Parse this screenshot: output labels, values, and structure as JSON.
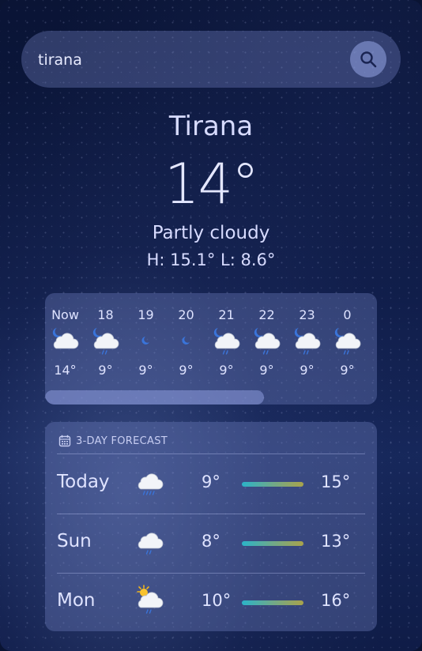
{
  "search": {
    "value": "tirana"
  },
  "current": {
    "city": "Tirana",
    "temperature": "14°",
    "condition": "Partly cloudy",
    "hilo": "H: 15.1° L: 8.6°"
  },
  "hourly": [
    {
      "time": "Now",
      "icon": "moon-cloud-icon",
      "temp": "14°"
    },
    {
      "time": "18",
      "icon": "moon-cloud-rain-icon",
      "temp": "9°"
    },
    {
      "time": "19",
      "icon": "moon-icon",
      "temp": "9°"
    },
    {
      "time": "20",
      "icon": "moon-icon",
      "temp": "9°"
    },
    {
      "time": "21",
      "icon": "moon-cloud-rain-icon",
      "temp": "9°"
    },
    {
      "time": "22",
      "icon": "moon-cloud-rain-icon",
      "temp": "9°"
    },
    {
      "time": "23",
      "icon": "moon-cloud-rain-icon",
      "temp": "9°"
    },
    {
      "time": "0",
      "icon": "moon-cloud-rain-icon",
      "temp": "9°"
    }
  ],
  "forecast": {
    "title": "3-DAY FORECAST",
    "days": [
      {
        "day": "Today",
        "icon": "cloud-heavy-rain-icon",
        "low": "9°",
        "high": "15°"
      },
      {
        "day": "Sun",
        "icon": "cloud-rain-icon",
        "low": "8°",
        "high": "13°"
      },
      {
        "day": "Mon",
        "icon": "sun-cloud-rain-icon",
        "low": "10°",
        "high": "16°"
      }
    ]
  }
}
